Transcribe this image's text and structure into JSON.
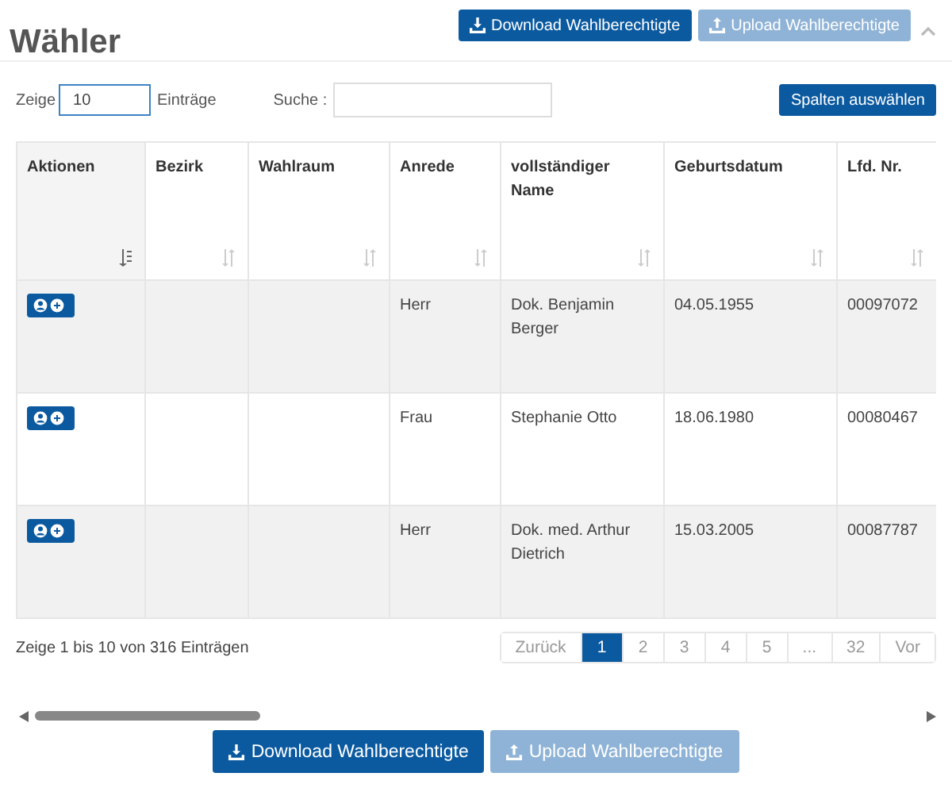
{
  "header": {
    "title": "Wähler",
    "buttons": [
      {
        "label": "Download Wahlberechtigte",
        "kind": "download",
        "disabled": false
      },
      {
        "label": "Upload Wahlberechtigte",
        "kind": "upload",
        "disabled": true
      }
    ],
    "collapse": {
      "expanded": true
    }
  },
  "controls": {
    "show_label": "Zeige",
    "page_size": "10",
    "entries_label": "Einträge",
    "search_label": "Suche :",
    "columns_button": "Spalten auswählen"
  },
  "table": {
    "columns": [
      {
        "label": "Aktionen",
        "sorted": true
      },
      {
        "label": "Bezirk",
        "sorted": false
      },
      {
        "label": "Wahlraum",
        "sorted": false
      },
      {
        "label": "Anrede",
        "sorted": false
      },
      {
        "label": "vollständiger Name",
        "sorted": false
      },
      {
        "label": "Geburtsdatum",
        "sorted": false
      },
      {
        "label": "Lfd. Nr.",
        "sorted": false
      }
    ],
    "rows": [
      {
        "cells": [
          "",
          "",
          "",
          "Herr",
          "Dok. Benjamin Berger",
          "04.05.1955",
          "00097072"
        ]
      },
      {
        "cells": [
          "",
          "",
          "",
          "Frau",
          "Stephanie Otto",
          "18.06.1980",
          "00080467"
        ]
      },
      {
        "cells": [
          "",
          "",
          "",
          "Herr",
          "Dok. med. Arthur Dietrich",
          "15.03.2005",
          "00087787"
        ]
      }
    ]
  },
  "info": "Zeige 1 bis 10 von 316 Einträgen",
  "pagination": [
    {
      "label": "Zurück",
      "selected": false,
      "disabled": true
    },
    {
      "label": "1",
      "selected": true,
      "disabled": false
    },
    {
      "label": "2",
      "selected": false,
      "disabled": true
    },
    {
      "label": "3",
      "selected": false,
      "disabled": true
    },
    {
      "label": "4",
      "selected": false,
      "disabled": true
    },
    {
      "label": "5",
      "selected": false,
      "disabled": true
    },
    {
      "label": "...",
      "selected": false,
      "disabled": true
    },
    {
      "label": "32",
      "selected": false,
      "disabled": true
    },
    {
      "label": "Vor",
      "selected": false,
      "disabled": true
    }
  ],
  "footer_buttons": [
    {
      "label": "Download Wahlberechtigte",
      "kind": "download",
      "disabled": false
    },
    {
      "label": "Upload Wahlberechtigte",
      "kind": "upload",
      "disabled": true
    }
  ]
}
